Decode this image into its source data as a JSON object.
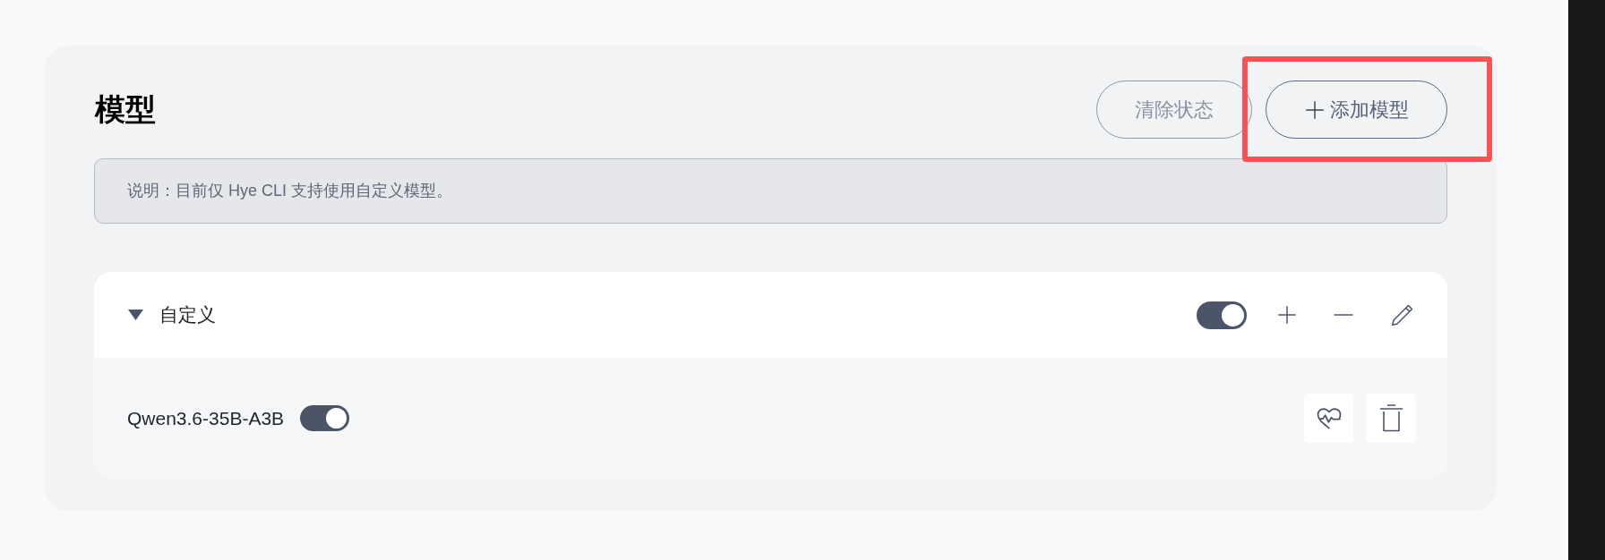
{
  "header": {
    "title": "模型",
    "buttons": [
      {
        "kind": "clear",
        "label": "清除状态",
        "disabled": true,
        "highlighted": false
      },
      {
        "kind": "add",
        "label": "添加模型",
        "disabled": false,
        "highlighted": true
      }
    ]
  },
  "note": "说明：目前仅 Hye CLI 支持使用自定义模型。",
  "groups": [
    {
      "name": "自定义",
      "expanded": true,
      "on": true,
      "models": [
        {
          "name": "Qwen3.6-35B-A3B",
          "on": true
        }
      ]
    }
  ]
}
